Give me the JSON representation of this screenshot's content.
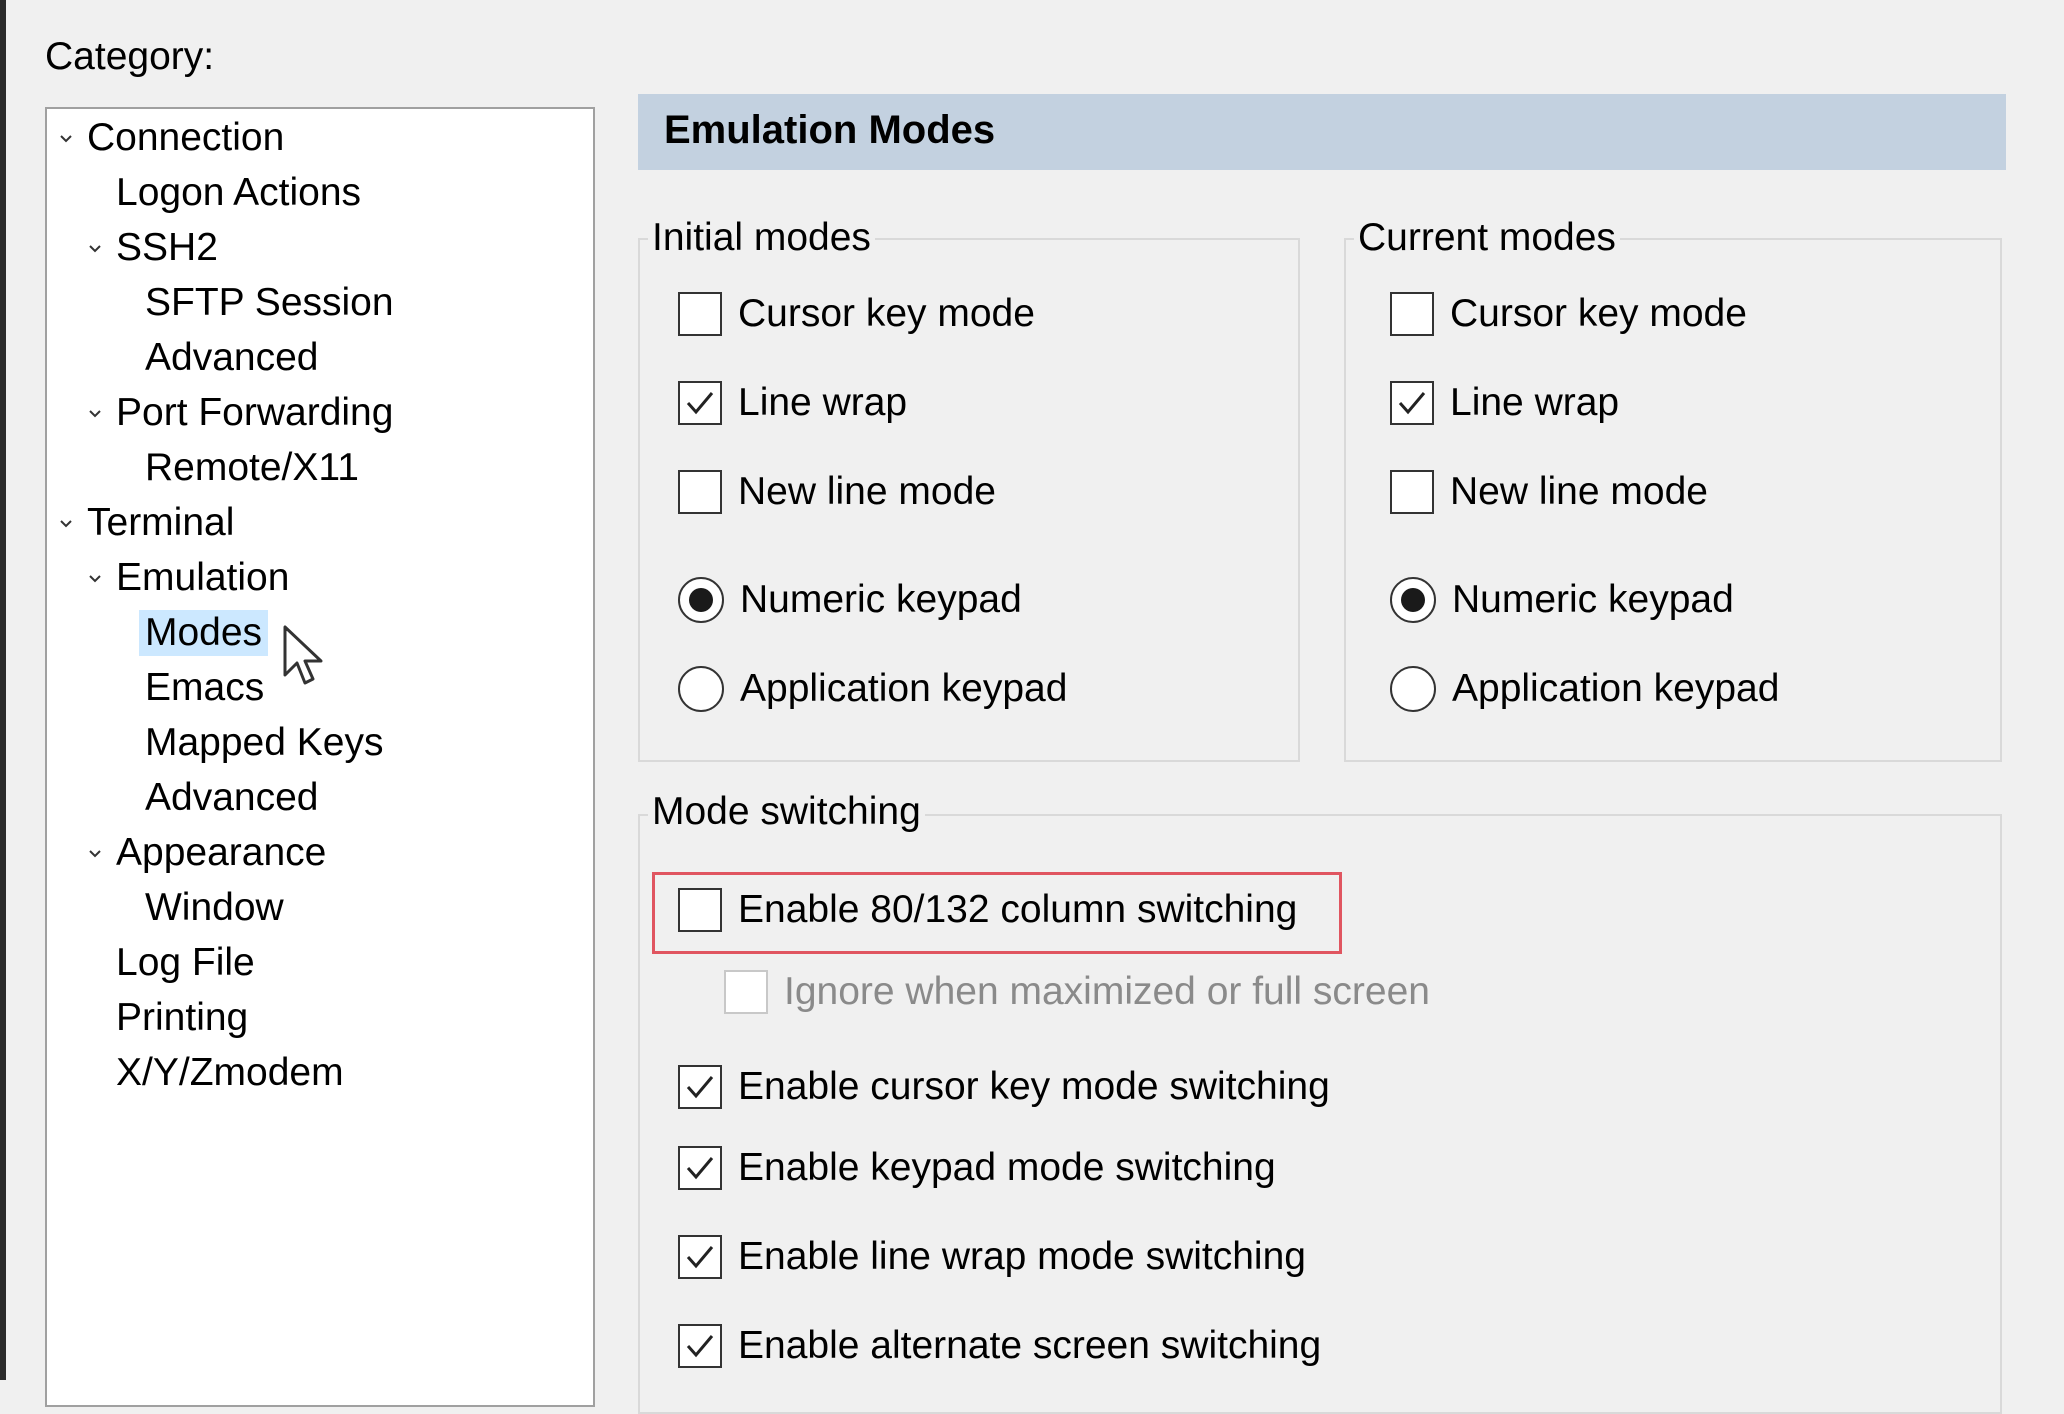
{
  "category_label": "Category:",
  "tree": {
    "items": [
      {
        "label": "Connection",
        "expanded": true
      },
      {
        "label": "Logon Actions"
      },
      {
        "label": "SSH2",
        "expanded": true
      },
      {
        "label": "SFTP Session"
      },
      {
        "label": "Advanced"
      },
      {
        "label": "Port Forwarding",
        "expanded": true
      },
      {
        "label": "Remote/X11"
      },
      {
        "label": "Terminal",
        "expanded": true
      },
      {
        "label": "Emulation",
        "expanded": true
      },
      {
        "label": "Modes",
        "selected": true
      },
      {
        "label": "Emacs"
      },
      {
        "label": "Mapped Keys"
      },
      {
        "label": "Advanced"
      },
      {
        "label": "Appearance",
        "expanded": true
      },
      {
        "label": "Window"
      },
      {
        "label": "Log File"
      },
      {
        "label": "Printing"
      },
      {
        "label": "X/Y/Zmodem"
      }
    ]
  },
  "panel": {
    "title": "Emulation Modes",
    "header_color": "#c3d1e0"
  },
  "initial_modes": {
    "title": "Initial modes",
    "cursor_key_mode": {
      "label": "Cursor key mode",
      "checked": false
    },
    "line_wrap": {
      "label": "Line wrap",
      "checked": true
    },
    "new_line_mode": {
      "label": "New line mode",
      "checked": false
    },
    "numeric_keypad": {
      "label": "Numeric keypad",
      "selected": true
    },
    "application_keypad": {
      "label": "Application keypad",
      "selected": false
    }
  },
  "current_modes": {
    "title": "Current modes",
    "cursor_key_mode": {
      "label": "Cursor key mode",
      "checked": false
    },
    "line_wrap": {
      "label": "Line wrap",
      "checked": true
    },
    "new_line_mode": {
      "label": "New line mode",
      "checked": false
    },
    "numeric_keypad": {
      "label": "Numeric keypad",
      "selected": true
    },
    "application_keypad": {
      "label": "Application keypad",
      "selected": false
    }
  },
  "mode_switching": {
    "title": "Mode switching",
    "enable_80_132": {
      "label": "Enable 80/132 column switching",
      "checked": false,
      "highlighted": true
    },
    "ignore_maximized": {
      "label": "Ignore when maximized or full screen",
      "checked": false,
      "disabled": true
    },
    "enable_cursor_key": {
      "label": "Enable cursor key mode switching",
      "checked": true
    },
    "enable_keypad": {
      "label": "Enable keypad mode switching",
      "checked": true
    },
    "enable_line_wrap": {
      "label": "Enable line wrap mode switching",
      "checked": true
    },
    "enable_alternate_screen": {
      "label": "Enable alternate screen switching",
      "checked": true
    }
  },
  "colors": {
    "highlight_box": "#e05560",
    "selection": "#cce8ff"
  }
}
